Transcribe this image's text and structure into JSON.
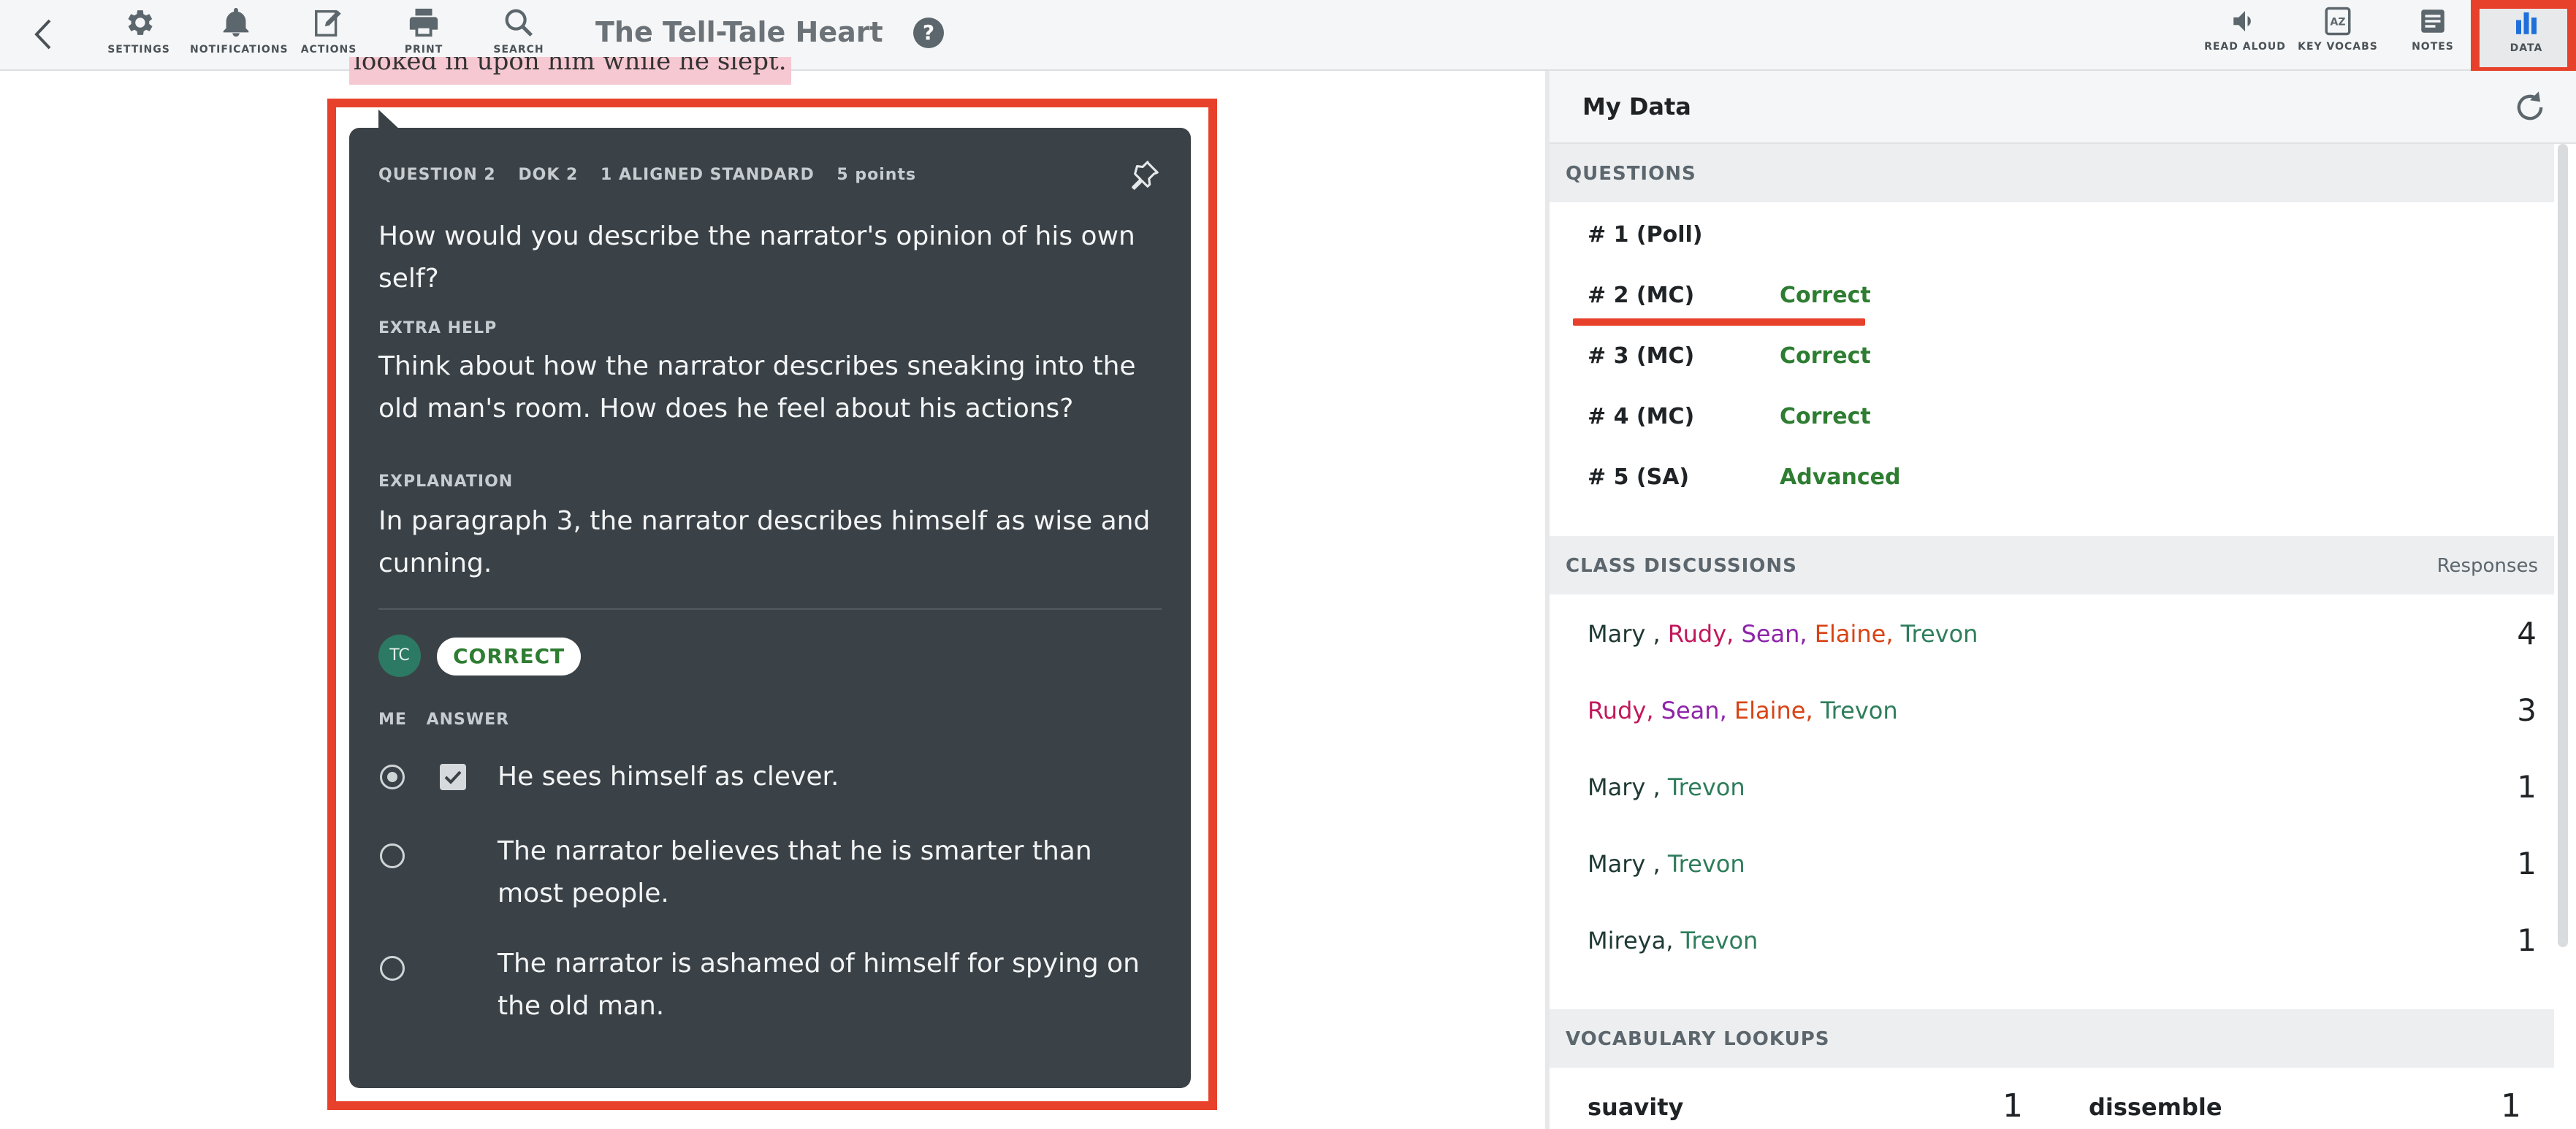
{
  "toolbar": {
    "settings": "SETTINGS",
    "notifications": "NOTIFICATIONS",
    "actions": "ACTIONS",
    "print": "PRINT",
    "search": "SEARCH",
    "title": "The Tell-Tale Heart",
    "help": "?",
    "read_aloud": "READ ALOUD",
    "key_vocabs": "KEY VOCABS",
    "notes": "NOTES",
    "data": "DATA"
  },
  "document": {
    "highlight_text": "looked in upon him while he slept."
  },
  "question": {
    "number": "QUESTION 2",
    "dok": "DOK 2",
    "standards": "1 ALIGNED STANDARD",
    "points": "5 points",
    "prompt": "How would you describe the narrator's opinion of his own self?",
    "extra_help_label": "EXTRA HELP",
    "extra_help": "Think about how the narrator describes sneaking into the old man's room. How does he feel about his actions?",
    "explanation_label": "EXPLANATION",
    "explanation": "In paragraph 3, the narrator describes himself as wise and cunning.",
    "avatar": "TC",
    "result": "CORRECT",
    "col_me": "ME",
    "col_answer": "ANSWER",
    "answers": [
      {
        "text": "He sees himself as clever.",
        "selected": true,
        "correct": true
      },
      {
        "text": "The narrator believes that he is smarter than most people.",
        "selected": false,
        "correct": false
      },
      {
        "text": "The narrator is ashamed of himself for spying on the old man.",
        "selected": false,
        "correct": false
      }
    ]
  },
  "panel": {
    "title": "My Data",
    "questions_label": "QUESTIONS",
    "questions": [
      {
        "name": "# 1 (Poll)",
        "status": ""
      },
      {
        "name": "# 2 (MC)",
        "status": "Correct"
      },
      {
        "name": "# 3 (MC)",
        "status": "Correct"
      },
      {
        "name": "# 4 (MC)",
        "status": "Correct"
      },
      {
        "name": "# 5 (SA)",
        "status": "Advanced"
      }
    ],
    "discussions_label": "CLASS DISCUSSIONS",
    "responses_label": "Responses",
    "discussions": [
      {
        "names": [
          "Mary ,",
          "Rudy,",
          "Sean,",
          "Elaine,",
          "Trevon"
        ],
        "count": "4"
      },
      {
        "names": [
          "Rudy,",
          "Sean,",
          "Elaine,",
          "Trevon"
        ],
        "count": "3"
      },
      {
        "names": [
          "Mary ,",
          "Trevon"
        ],
        "count": "1"
      },
      {
        "names": [
          "Mary ,",
          "Trevon"
        ],
        "count": "1"
      },
      {
        "names": [
          "Mireya,",
          "Trevon"
        ],
        "count": "1"
      }
    ],
    "vocab_label": "VOCABULARY LOOKUPS",
    "vocab": [
      {
        "word": "suavity",
        "count": "1"
      },
      {
        "word": "dissemble",
        "count": "1"
      }
    ]
  },
  "colors": {
    "accent_red": "#e8412b",
    "card_bg": "#3b4247",
    "correct_green": "#2e7d32",
    "data_blue": "#1e6fd9"
  }
}
